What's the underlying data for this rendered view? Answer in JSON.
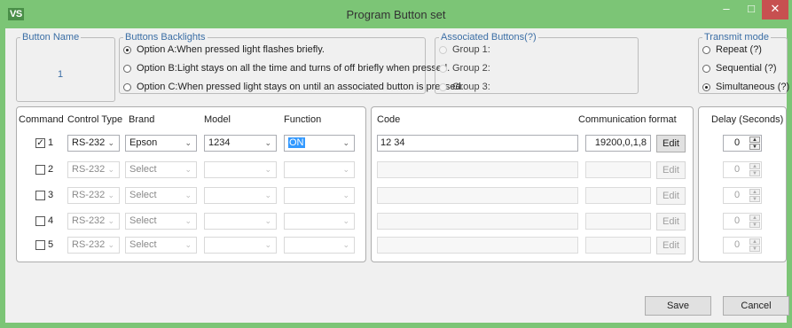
{
  "window": {
    "logo": "VS",
    "title": "Program Button set",
    "min": "–",
    "max": "□",
    "close": "✕"
  },
  "button_name": {
    "legend": "Button  Name",
    "value": "1"
  },
  "backlights": {
    "legend": "Buttons Backlights",
    "options": [
      {
        "label": "Option A:When pressed light flashes briefly.",
        "selected": true
      },
      {
        "label": "Option B:Light stays on all the time and turns of off briefly when pressed.",
        "selected": false
      },
      {
        "label": "Option C:When pressed light stays on until an associated button is pressed.",
        "selected": false
      }
    ]
  },
  "associated": {
    "legend": "Associated Buttons(?)",
    "groups": [
      "Group 1:",
      "Group 2:",
      "Group 3:"
    ]
  },
  "transmit": {
    "legend": "Transmit mode",
    "options": [
      {
        "label": "Repeat (?)",
        "selected": false
      },
      {
        "label": "Sequential (?)",
        "selected": false
      },
      {
        "label": "Simultaneous (?)",
        "selected": true
      }
    ]
  },
  "headers": {
    "command": "Command",
    "control_type": "Control Type",
    "brand": "Brand",
    "model": "Model",
    "function": "Function",
    "code": "Code",
    "comm_format": "Communication format",
    "delay": "Delay (Seconds)"
  },
  "rows": [
    {
      "num": "1",
      "checked": true,
      "check_mark": "✓",
      "control": "RS-232",
      "brand": "Epson",
      "model": "1234",
      "function": "ON",
      "code": "12 34",
      "comm": "19200,0,1,8",
      "edit": "Edit",
      "delay": "0"
    },
    {
      "num": "2",
      "checked": false,
      "check_mark": "",
      "control": "RS-232",
      "brand": "Select",
      "model": "",
      "function": "",
      "code": "",
      "comm": "",
      "edit": "Edit",
      "delay": "0"
    },
    {
      "num": "3",
      "checked": false,
      "check_mark": "",
      "control": "RS-232",
      "brand": "Select",
      "model": "",
      "function": "",
      "code": "",
      "comm": "",
      "edit": "Edit",
      "delay": "0"
    },
    {
      "num": "4",
      "checked": false,
      "check_mark": "",
      "control": "RS-232",
      "brand": "Select",
      "model": "",
      "function": "",
      "code": "",
      "comm": "",
      "edit": "Edit",
      "delay": "0"
    },
    {
      "num": "5",
      "checked": false,
      "check_mark": "",
      "control": "RS-232",
      "brand": "Select",
      "model": "",
      "function": "",
      "code": "",
      "comm": "",
      "edit": "Edit",
      "delay": "0"
    }
  ],
  "glyphs": {
    "dropdown_arrow": "⌄",
    "spin_up": "▲",
    "spin_down": "▼"
  },
  "actions": {
    "save": "Save",
    "cancel": "Cancel"
  },
  "colors": {
    "titlebar": "#7cc576",
    "legend": "#3b6ea5",
    "close": "#c75050",
    "highlight": "#3399ff"
  }
}
